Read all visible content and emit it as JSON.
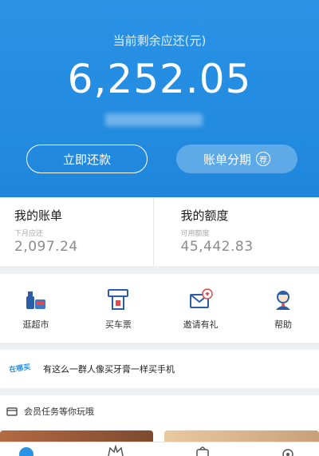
{
  "header": {
    "balance_label": "当前剩余应还(元)",
    "balance_amount": "6,252.05",
    "repay_button": "立即还款",
    "installment_button": "账单分期",
    "installment_badge": "荐",
    "colors": {
      "accent": "#2a93e6"
    }
  },
  "summary": {
    "bill": {
      "title": "我的账单",
      "subtitle": "下月应还",
      "value": "2,097.24"
    },
    "quota": {
      "title": "我的额度",
      "subtitle": "可用额度",
      "value": "45,442.83"
    }
  },
  "quick_actions": [
    {
      "label": "逛超市",
      "icon": "supermarket-icon"
    },
    {
      "label": "买车票",
      "icon": "ticket-icon"
    },
    {
      "label": "邀请有礼",
      "icon": "invite-mail-icon"
    },
    {
      "label": "帮助",
      "icon": "help-agent-icon"
    }
  ],
  "promo": {
    "logo_text": "在哪买",
    "text": "有这么一群人像买牙膏一样买手机"
  },
  "tasks": {
    "title": "会员任务等你玩哦"
  },
  "tabbar": {
    "icons": [
      "home-icon",
      "crown-icon",
      "bag-icon",
      "gear-icon"
    ]
  }
}
